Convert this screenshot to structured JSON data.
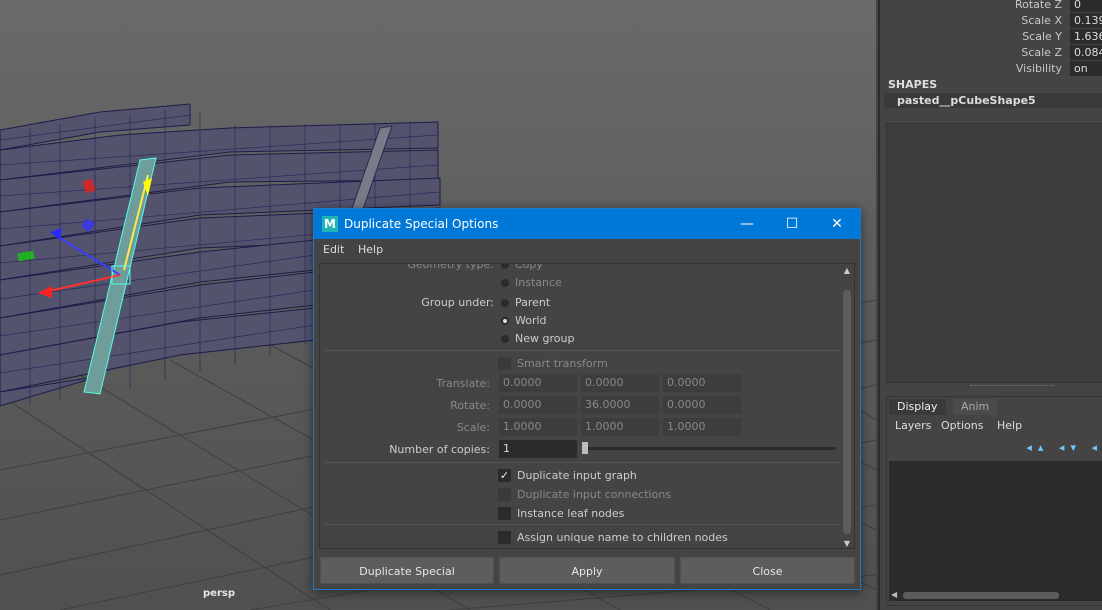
{
  "viewport": {
    "camera_label": "persp"
  },
  "attributes": [
    {
      "label": "Rotate Z",
      "value": "0"
    },
    {
      "label": "Scale X",
      "value": "0.139"
    },
    {
      "label": "Scale Y",
      "value": "1.636"
    },
    {
      "label": "Scale Z",
      "value": "0.084"
    },
    {
      "label": "Visibility",
      "value": "on"
    }
  ],
  "shapes": {
    "heading": "SHAPES",
    "name": "pasted__pCubeShape5"
  },
  "layers": {
    "tabs": [
      "Display",
      "Anim"
    ],
    "menu": [
      "Layers",
      "Options",
      "Help"
    ],
    "icon_arrows": "◂▴ ◂▾ ◂"
  },
  "dialog": {
    "title": "Duplicate Special Options",
    "app_icon": "M",
    "window_buttons": {
      "minimize": "—",
      "maximize": "☐",
      "close": "✕"
    },
    "menu": [
      "Edit",
      "Help"
    ],
    "geometry_type": {
      "label": "Geometry type:",
      "options": [
        "Copy",
        "Instance"
      ]
    },
    "group_under": {
      "label": "Group under:",
      "options": [
        "Parent",
        "World",
        "New group"
      ],
      "selected": "World"
    },
    "smart_transform": {
      "label": "Smart transform",
      "checked": false
    },
    "translate": {
      "label": "Translate:",
      "values": [
        "0.0000",
        "0.0000",
        "0.0000"
      ]
    },
    "rotate": {
      "label": "Rotate:",
      "values": [
        "0.0000",
        "36.0000",
        "0.0000"
      ]
    },
    "scale": {
      "label": "Scale:",
      "values": [
        "1.0000",
        "1.0000",
        "1.0000"
      ]
    },
    "copies": {
      "label": "Number of copies:",
      "value": "1"
    },
    "duplicate_input_graph": {
      "label": "Duplicate input graph",
      "checked": true,
      "mark": "✓"
    },
    "duplicate_input_connections": {
      "label": "Duplicate input connections",
      "checked": false
    },
    "instance_leaf_nodes": {
      "label": "Instance leaf nodes",
      "checked": false
    },
    "assign_unique_name": {
      "label": "Assign unique name to children nodes",
      "checked": false
    },
    "buttons": {
      "duplicate": "Duplicate Special",
      "apply": "Apply",
      "close": "Close"
    }
  }
}
